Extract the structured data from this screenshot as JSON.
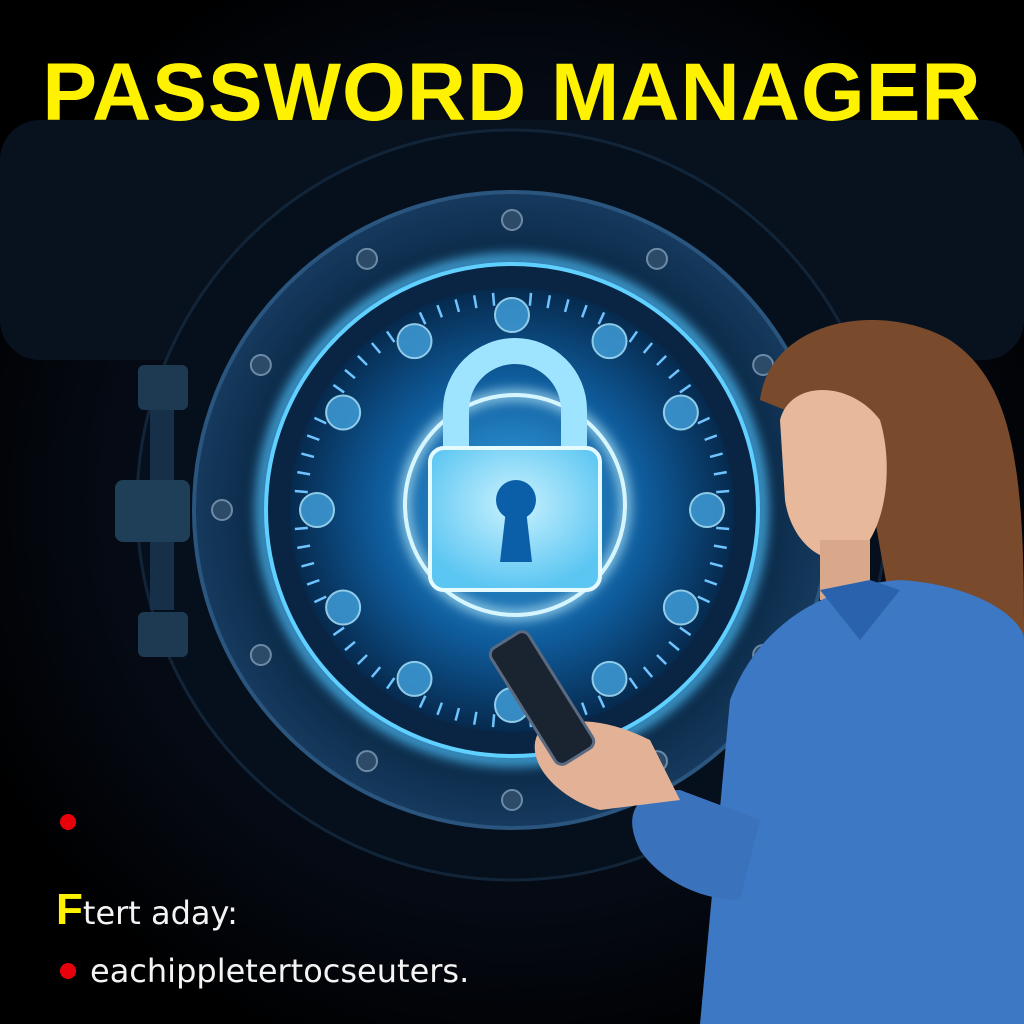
{
  "title": "PASSWORD MANAGER",
  "lines": {
    "first_letter": "F",
    "heading_rest": "tert aday:",
    "bullet_text": "eachippletertocseuters."
  },
  "icons": [
    "padlock-icon",
    "keyhole-icon",
    "vault-door",
    "smartphone",
    "bullet-dot"
  ],
  "colors": {
    "title": "#fff200",
    "bullet": "#e8000b",
    "glow": "#4fc3ff",
    "background": "#000000"
  }
}
